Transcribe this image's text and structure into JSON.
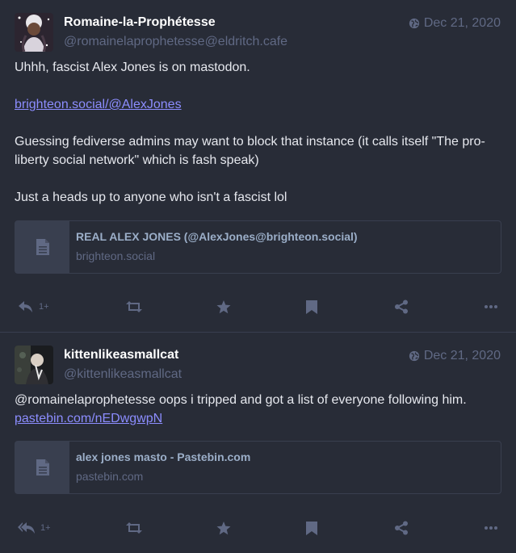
{
  "statuses": [
    {
      "display_name": "Romaine-la-Prophétesse",
      "acct": "@romainelaprophetesse@eldritch.cafe",
      "time": "Dec 21, 2020",
      "paragraphs": [
        "Uhhh, fascist Alex Jones is on mastodon.",
        "Guessing fediverse admins may want to block that instance (it calls itself \"The pro-liberty social network\" which is fash speak)",
        "Just a heads up to anyone who isn't a fascist lol"
      ],
      "link": "brighteon.social/@AlexJones",
      "card": {
        "title": "REAL ALEX JONES (@AlexJones@brighteon.social)",
        "host": "brighteon.social",
        "icon": "file-icon"
      },
      "reply_count": "1+"
    },
    {
      "display_name": "kittenlikeasmallcat",
      "acct": "@kittenlikeasmallcat",
      "time": "Dec 21, 2020",
      "text": "@romainelaprophetesse oops i tripped and got a list of everyone following him.",
      "link": "pastebin.com/nEDwgwpN",
      "card": {
        "title": "alex jones masto - Pastebin.com",
        "host": "pastebin.com",
        "icon": "file-icon"
      },
      "reply_count": "1+"
    }
  ],
  "icons": [
    "globe-icon",
    "reply-icon",
    "reply-all-icon",
    "boost-icon",
    "star-icon",
    "bookmark-icon",
    "share-icon",
    "ellipsis-icon",
    "file-icon"
  ],
  "colors": {
    "background": "#282c37",
    "muted": "#606984",
    "link": "#8c8dff",
    "border": "#393f4f"
  }
}
